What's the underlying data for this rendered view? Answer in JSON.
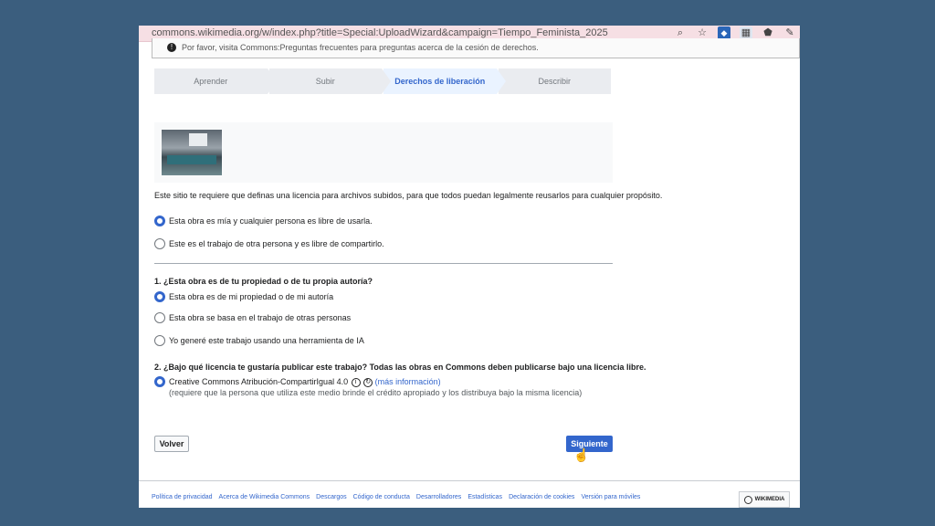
{
  "browser": {
    "url": "commons.wikimedia.org/w/index.php?title=Special:UploadWizard&campaign=Tiempo_Feminista_2025"
  },
  "notice": {
    "text": "Por favor, visita Commons:Preguntas frecuentes para preguntas acerca de la cesión de derechos."
  },
  "steps": [
    {
      "label": "Aprender",
      "active": false
    },
    {
      "label": "Subir",
      "active": false
    },
    {
      "label": "Derechos de liberación",
      "active": true
    },
    {
      "label": "Describir",
      "active": false
    }
  ],
  "license_intro": "Este sitio te requiere que definas una licencia para archivos subidos, para que todos puedan legalmente reusarlos para cualquier propósito.",
  "ownership": {
    "own_work": "Esta obra es mía y cualquier persona es libre de usarla.",
    "others_work": "Este es el trabajo de otra persona y es libre de compartirlo.",
    "selected": "own_work"
  },
  "question1": {
    "title": "1. ¿Esta obra es de tu propiedad o de tu propia autoría?",
    "options": [
      "Esta obra es de mi propiedad o de mi autoría",
      "Esta obra se basa en el trabajo de otras personas",
      "Yo generé este trabajo usando una herramienta de IA"
    ],
    "selected": 0
  },
  "question2": {
    "title": "2. ¿Bajo qué licencia te gustaría publicar este trabajo? Todas las obras en Commons deben publicarse bajo una licencia libre.",
    "license_name": "Creative Commons Atribución-CompartirIgual 4.0",
    "more_info": "(más información)",
    "note": "(requiere que la persona que utiliza este medio brinde el crédito apropiado y los distribuya bajo la misma licencia)"
  },
  "buttons": {
    "back": "Volver",
    "next": "Siguiente"
  },
  "footer": {
    "links": [
      "Política de privacidad",
      "Acerca de Wikimedia Commons",
      "Descargos",
      "Código de conducta",
      "Desarrolladores",
      "Estadísticas",
      "Declaración de cookies",
      "Versión para móviles"
    ],
    "badge": "WIKIMEDIA"
  },
  "colors": {
    "accent": "#3366cc",
    "background": "#3b5e7e"
  }
}
